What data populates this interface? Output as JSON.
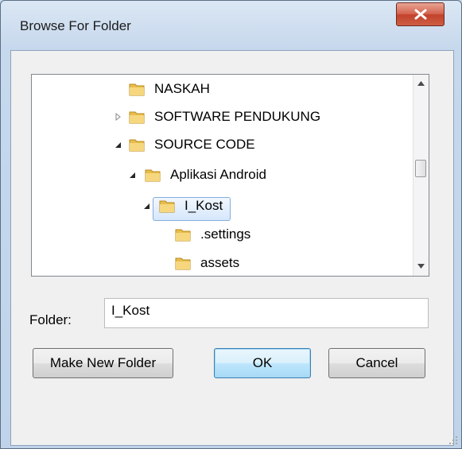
{
  "dialog": {
    "title": "Browse For Folder",
    "close_icon": "close-icon"
  },
  "tree": {
    "items": [
      {
        "label": "NASKAH",
        "expander": "none"
      },
      {
        "label": "SOFTWARE PENDUKUNG",
        "expander": "collapsed"
      },
      {
        "label": "SOURCE CODE",
        "expander": "expanded"
      },
      {
        "label": "Aplikasi Android",
        "expander": "expanded"
      },
      {
        "label": "I_Kost",
        "expander": "expanded",
        "selected": true
      },
      {
        "label": ".settings",
        "expander": "none"
      },
      {
        "label": "assets",
        "expander": "none"
      }
    ]
  },
  "folder_field": {
    "label": "Folder:",
    "value": "I_Kost"
  },
  "buttons": {
    "make_new_folder": "Make New Folder",
    "ok": "OK",
    "cancel": "Cancel"
  },
  "colors": {
    "selection": "#d6e7fb",
    "close_button": "#c2422c",
    "folder": "#e8bd4d"
  }
}
